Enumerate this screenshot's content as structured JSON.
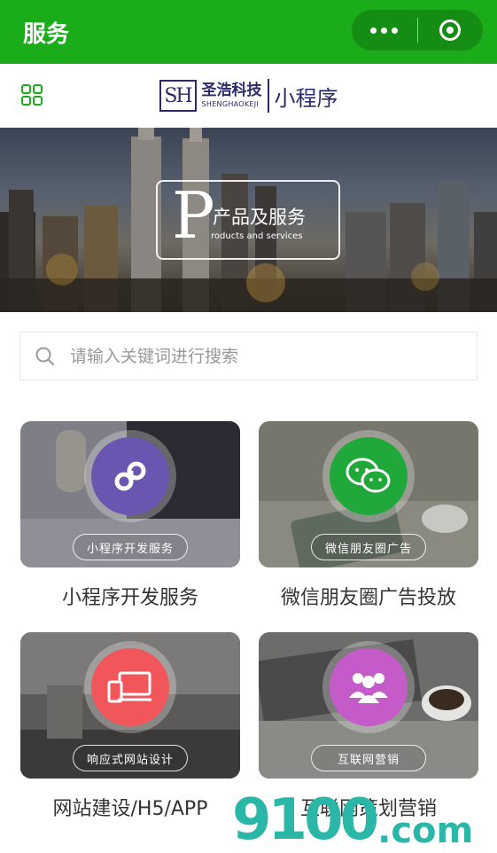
{
  "topbar": {
    "title": "服务"
  },
  "header": {
    "logo_mark": "SH",
    "logo_cn": "圣浩科技",
    "logo_en": "SHENGHAOKEJI",
    "logo_mini": "小程序"
  },
  "banner": {
    "letter": "P",
    "title_cn": "产品及服务",
    "title_en": "roducts and services"
  },
  "search": {
    "placeholder": "请输入关键词进行搜索"
  },
  "services": [
    {
      "pill": "小程序开发服务",
      "caption": "小程序开发服务",
      "icon": "mini-program-icon",
      "color": "#6a55b0"
    },
    {
      "pill": "微信朋友圈广告",
      "caption": "微信朋友圈广告投放",
      "icon": "wechat-icon",
      "color": "#20a83a"
    },
    {
      "pill": "响应式网站设计",
      "caption": "网站建设/H5/APP",
      "icon": "devices-icon",
      "color": "#f0565a"
    },
    {
      "pill": "互联网营销",
      "caption": "互联网策划营销",
      "icon": "people-icon",
      "color": "#c55bc9"
    }
  ],
  "watermark": {
    "digits": "9100",
    "domain": ".com"
  }
}
